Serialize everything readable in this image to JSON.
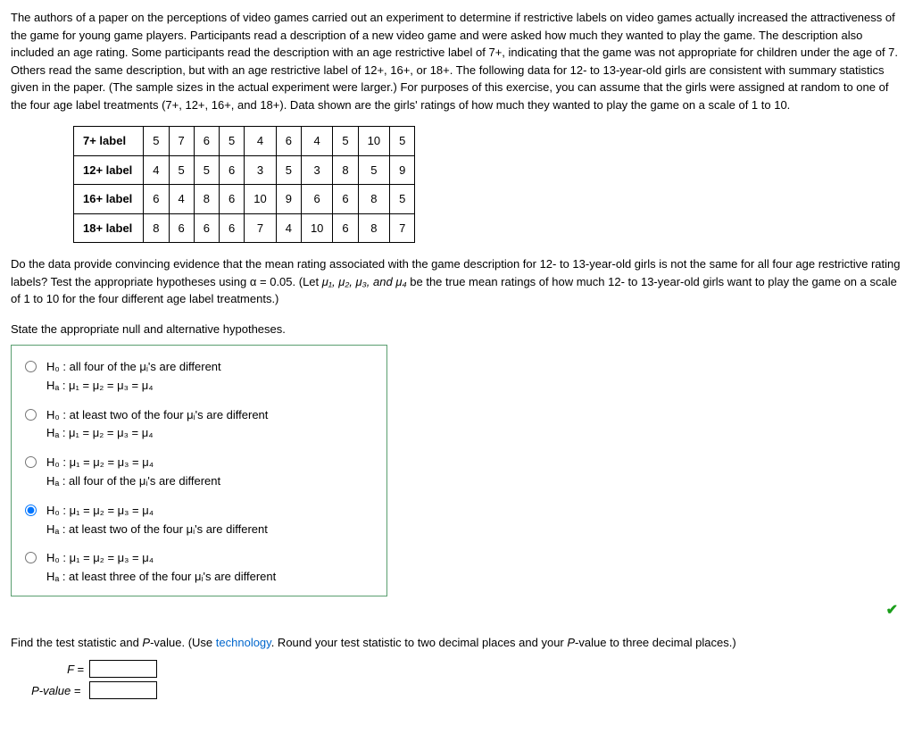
{
  "intro": "The authors of a paper on the perceptions of video games carried out an experiment to determine if restrictive labels on video games actually increased the attractiveness of the game for young game players. Participants read a description of a new video game and were asked how much they wanted to play the game. The description also included an age rating. Some participants read the description with an age restrictive label of 7+, indicating that the game was not appropriate for children under the age of 7. Others read the same description, but with an age restrictive label of 12+, 16+, or 18+. The following data for 12- to 13-year-old girls are consistent with summary statistics given in the paper. (The sample sizes in the actual experiment were larger.) For purposes of this exercise, you can assume that the girls were assigned at random to one of the four age label treatments (7+, 12+, 16+, and 18+). Data shown are the girls' ratings of how much they wanted to play the game on a scale of 1 to 10.",
  "table": {
    "rows": [
      {
        "label": "7+ label",
        "values": [
          "5",
          "7",
          "6",
          "5",
          "4",
          "6",
          "4",
          "5",
          "10",
          "5"
        ]
      },
      {
        "label": "12+ label",
        "values": [
          "4",
          "5",
          "5",
          "6",
          "3",
          "5",
          "3",
          "8",
          "5",
          "9"
        ]
      },
      {
        "label": "16+ label",
        "values": [
          "6",
          "4",
          "8",
          "6",
          "10",
          "9",
          "6",
          "6",
          "8",
          "5"
        ]
      },
      {
        "label": "18+ label",
        "values": [
          "8",
          "6",
          "6",
          "6",
          "7",
          "4",
          "10",
          "6",
          "8",
          "7"
        ]
      }
    ]
  },
  "question_p1": "Do the data provide convincing evidence that the mean rating associated with the game description for 12- to 13-year-old girls is not the same for all four age restrictive rating labels? Test the appropriate hypotheses using α = 0.05. (Let ",
  "question_p2": " be the true mean ratings of how much 12- to 13-year-old girls want to play the game on a scale of 1 to 10 for the four different age label treatments.)",
  "mu_list": "μ₁, μ₂, μ₃, and μ₄",
  "prompt": "State the appropriate null and alternative hypotheses.",
  "options": {
    "opt1_h0": "H₀ : all four of the μᵢ's are different",
    "opt1_ha": "Hₐ : μ₁ = μ₂ = μ₃ = μ₄",
    "opt2_h0": "H₀ : at least two of the four μᵢ's are different",
    "opt2_ha": "Hₐ : μ₁ = μ₂ = μ₃ = μ₄",
    "opt3_h0": "H₀ : μ₁ = μ₂ = μ₃ = μ₄",
    "opt3_ha": "Hₐ : all four of the μᵢ's are different",
    "opt4_h0": "H₀ : μ₁ = μ₂ = μ₃ = μ₄",
    "opt4_ha": "Hₐ : at least two of the four μᵢ's are different",
    "opt5_h0": "H₀ : μ₁ = μ₂ = μ₃ = μ₄",
    "opt5_ha": "Hₐ : at least three of the four μᵢ's are different"
  },
  "selected_option": 4,
  "find_p1": "Find the test statistic and ",
  "find_pv": "P",
  "find_p2": "-value. (Use ",
  "tech_link": "technology",
  "find_p3": ". Round your test statistic to two decimal places and your ",
  "find_p4": "-value to three decimal places.)",
  "labels": {
    "F": "F = ",
    "Pvalue": "P-value = "
  }
}
